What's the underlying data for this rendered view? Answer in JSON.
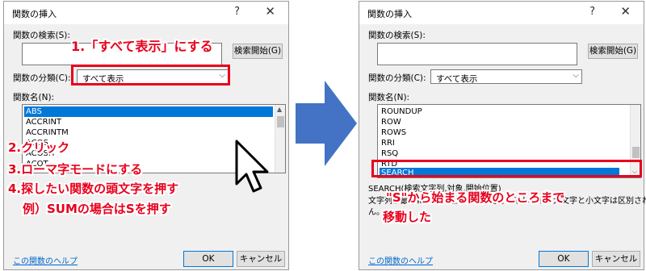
{
  "dialog1": {
    "title": "関数の挿入",
    "help": "?",
    "close": "✕",
    "search_label": "関数の検索(S):",
    "search_value": "",
    "search_button": "検索開始(G)",
    "category_label": "関数の分類(C):",
    "category_value": "すべて表示",
    "list_label": "関数名(N):",
    "list_items": [
      "ABS",
      "ACCRINT",
      "ACCRINTM",
      "ACOS",
      "ACOSH",
      "ACOT"
    ],
    "help_link": "この関数のヘルプ",
    "ok": "OK",
    "cancel": "キャンセル"
  },
  "dialog2": {
    "title": "関数の挿入",
    "help": "?",
    "close": "✕",
    "search_label": "関数の検索(S):",
    "search_value": "",
    "search_button": "検索開始(G)",
    "category_label": "関数の分類(C):",
    "category_value": "すべて表示",
    "list_label": "関数名(N):",
    "list_items": [
      "ROUNDUP",
      "ROW",
      "ROWS",
      "RRI",
      "RSQ",
      "RTD",
      "SEARCH"
    ],
    "description_1": "SEARCH(検索文字列,対象,開始位置)",
    "description_2": "文字列が最初に現れる位置の文字番号を返します。大文字と小文字は区別されませ",
    "description_3": "ん。",
    "help_link": "この関数のヘルプ",
    "ok": "OK",
    "cancel": "キャンセル"
  },
  "annotations": {
    "step1": "1.「すべて表示」にする",
    "step2": "2.クリック",
    "step3": "3.ローマ字モードにする",
    "step4": "4.探したい関数の頭文字を押す",
    "step4_example": "例）SUMの場合はSを押す",
    "result_1": "\"S\"から始まる関数のところまで",
    "result_2": "移動した"
  },
  "colors": {
    "annotation_red": "#e8001c",
    "selection_blue": "#0078d7",
    "arrow_blue": "#4472c4"
  }
}
